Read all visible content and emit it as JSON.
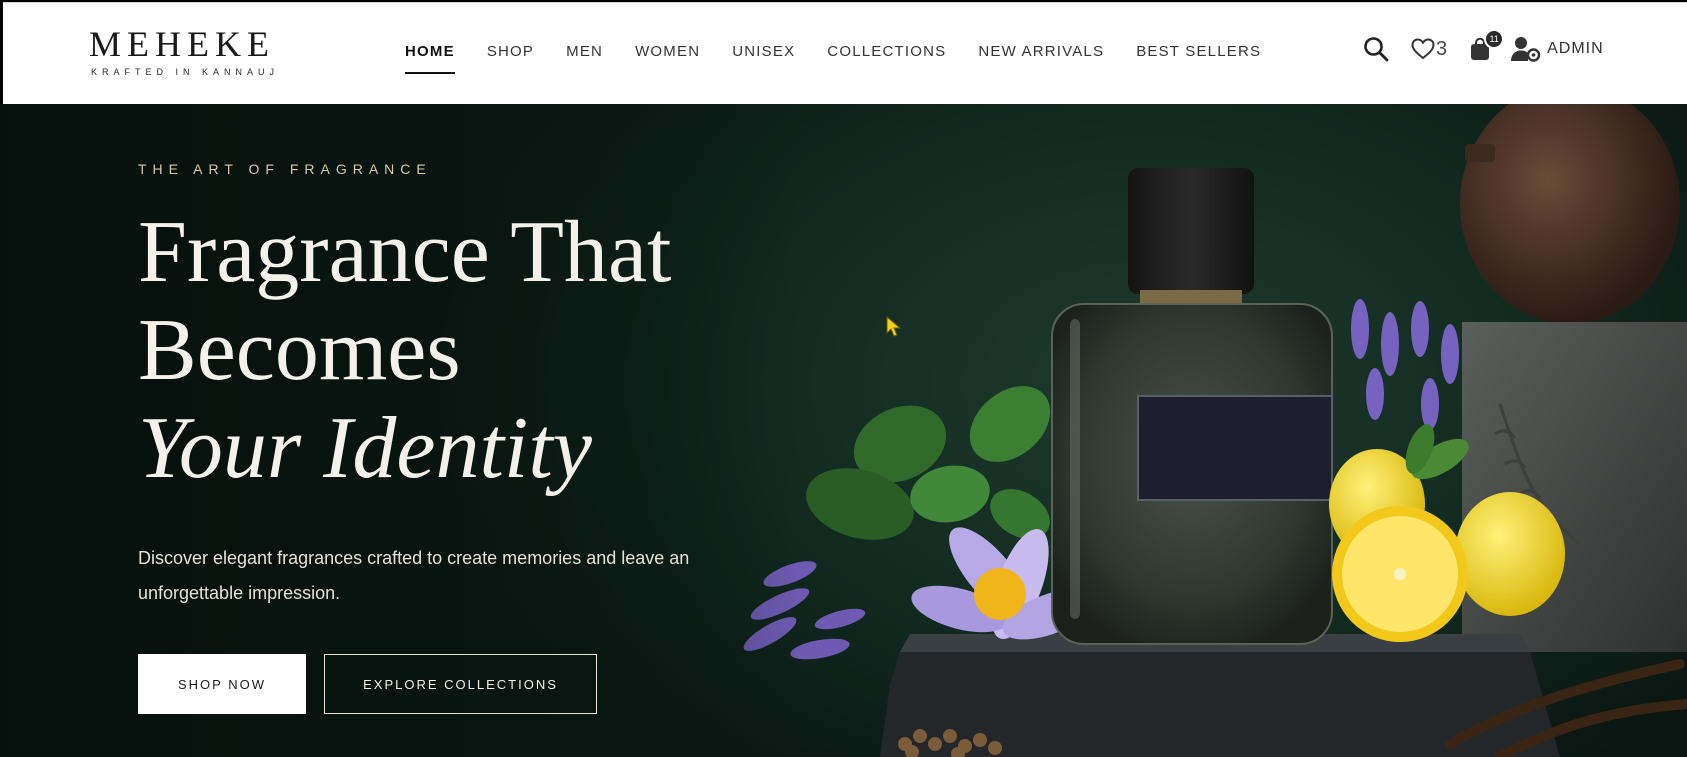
{
  "brand": {
    "name": "MEHEKE",
    "tagline": "KRAFTED IN KANNAUJ"
  },
  "nav": {
    "items": [
      {
        "label": "HOME",
        "active": true
      },
      {
        "label": "SHOP",
        "active": false
      },
      {
        "label": "MEN",
        "active": false
      },
      {
        "label": "WOMEN",
        "active": false
      },
      {
        "label": "UNISEX",
        "active": false
      },
      {
        "label": "COLLECTIONS",
        "active": false
      },
      {
        "label": "NEW ARRIVALS",
        "active": false
      },
      {
        "label": "BEST SELLERS",
        "active": false
      }
    ]
  },
  "header_icons": {
    "search_icon": "search-icon",
    "wishlist_icon": "heart-icon",
    "wishlist_count": "3",
    "cart_icon": "shopping-bag-icon",
    "cart_count": "11",
    "user_icon": "user-gear-icon",
    "user_label": "ADMIN"
  },
  "hero": {
    "eyebrow": "THE ART OF FRAGRANCE",
    "headline_line1": "Fragrance That",
    "headline_line2": "Becomes",
    "headline_line3": "Your Identity",
    "subtext_line1": "Discover elegant fragrances crafted to create memories and leave an",
    "subtext_line2": "unforgettable impression.",
    "primary_button": "SHOP NOW",
    "secondary_button": "EXPLORE COLLECTIONS",
    "image_subject": "perfume-bottle-with-botanicals"
  },
  "colors": {
    "hero_bg": "#0f241c",
    "header_bg": "#ffffff",
    "eyebrow": "#d8c9a8",
    "headline": "#f4f1ea"
  }
}
